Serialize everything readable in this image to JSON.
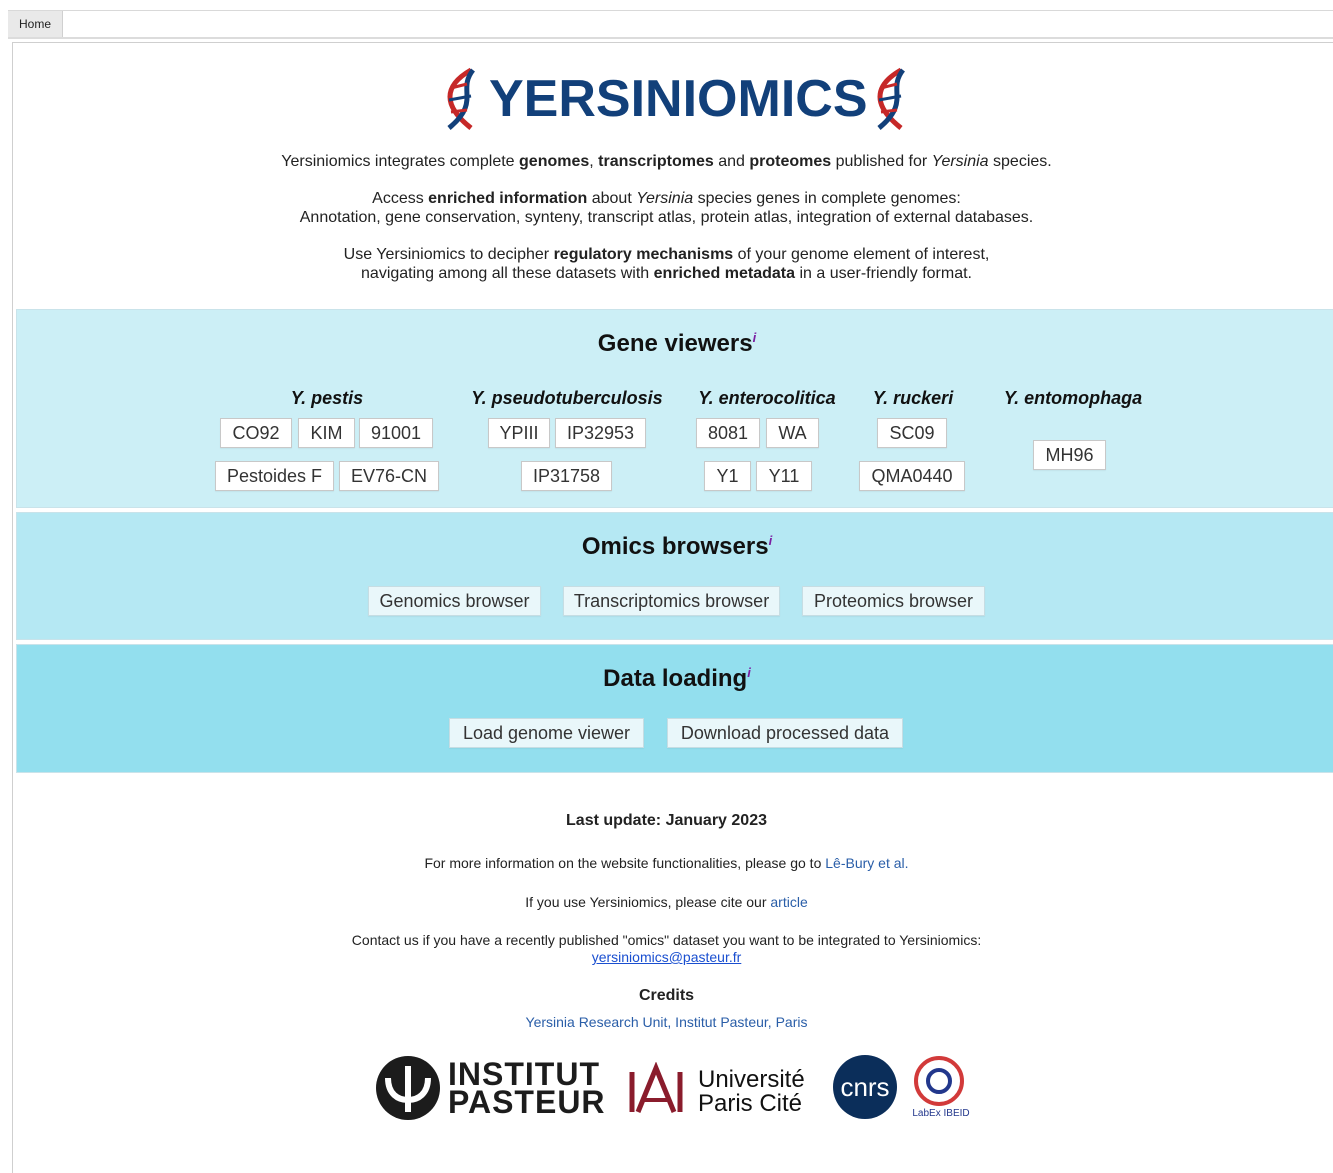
{
  "tabs": {
    "home": "Home"
  },
  "logo": {
    "text": "YERSINIOMICS"
  },
  "intro": {
    "l1": [
      "Yersiniomics integrates complete ",
      "genomes",
      ", ",
      "transcriptomes",
      " and ",
      "proteomes",
      " published for ",
      "Yersinia",
      " species."
    ],
    "l2": [
      "Access ",
      "enriched information",
      " about ",
      "Yersinia",
      " species genes in complete genomes:"
    ],
    "l3": "Annotation, gene conservation, synteny, transcript atlas, protein atlas, integration of external databases.",
    "l4": [
      "Use Yersiniomics to decipher ",
      "regulatory mechanisms",
      " of your genome element of interest,"
    ],
    "l5": [
      "navigating among all these datasets with ",
      "enriched metadata",
      " in a user-friendly format."
    ]
  },
  "gene_viewers": {
    "title": "Gene viewers",
    "info": "i",
    "species": [
      {
        "name": "Y. pestis",
        "strains": [
          "CO92",
          "KIM",
          "91001",
          "Pestoides F",
          "EV76-CN"
        ]
      },
      {
        "name": "Y. pseudotuberculosis",
        "strains": [
          "YPIII",
          "IP32953",
          "IP31758"
        ]
      },
      {
        "name": "Y. enterocolitica",
        "strains": [
          "8081",
          "WA",
          "Y1",
          "Y11"
        ]
      },
      {
        "name": "Y. ruckeri",
        "strains": [
          "SC09",
          "QMA0440"
        ]
      },
      {
        "name": "Y. entomophaga",
        "strains": [
          "MH96"
        ]
      }
    ]
  },
  "omics_browsers": {
    "title": "Omics browsers",
    "info": "i",
    "buttons": [
      "Genomics browser",
      "Transcriptomics browser",
      "Proteomics browser"
    ]
  },
  "data_loading": {
    "title": "Data loading",
    "info": "i",
    "buttons": [
      "Load genome viewer",
      "Download processed data"
    ]
  },
  "footer": {
    "last_update": "Last update: January 2023",
    "more_info_prefix": "For more information on the website functionalities, please go to ",
    "more_info_link": "Lê-Bury et al.",
    "cite_prefix": "If you use Yersiniomics, please cite our ",
    "cite_link": "article",
    "contact": "Contact us if you have a recently published \"omics\" dataset you want to be integrated to Yersiniomics:",
    "email": "yersiniomics@pasteur.fr",
    "credits_title": "Credits",
    "credits_link": "Yersinia Research Unit, Institut Pasteur, Paris"
  },
  "logos": {
    "pasteur_l1": "INSTITUT",
    "pasteur_l2": "PASTEUR",
    "upc_l1": "Université",
    "upc_l2": "Paris Cité",
    "cnrs": "cnrs",
    "labex": "LabEx IBEID"
  },
  "colors": {
    "navy": "#12407a",
    "dna_red": "#c62828",
    "band1": "#cceff6",
    "band2": "#b5e8f3",
    "band3": "#93dfee"
  }
}
